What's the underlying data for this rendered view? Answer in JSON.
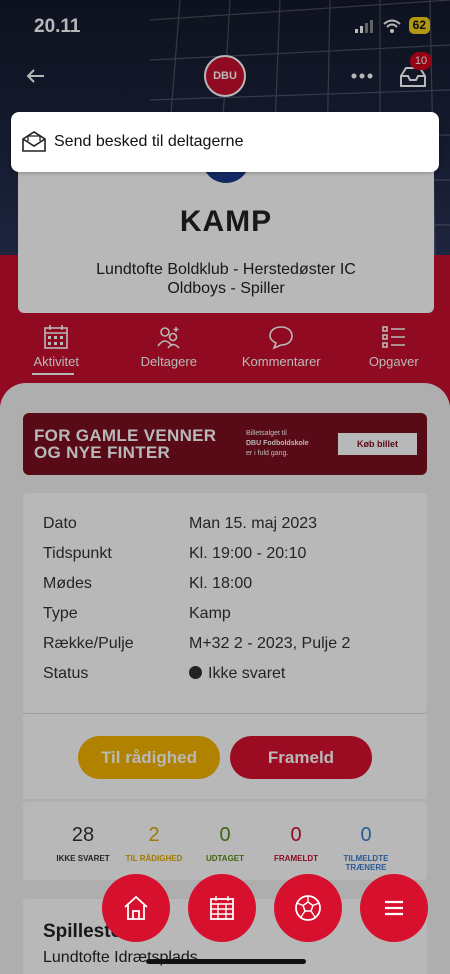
{
  "status_bar": {
    "time": "20.11",
    "battery": "62"
  },
  "header": {
    "logo_text": "DBU",
    "inbox_badge": "10"
  },
  "toast": {
    "label": "Send besked til deltagerne"
  },
  "event_card": {
    "title": "KAMP",
    "subtitle_line1": "Lundtofte Boldklub - Herstedøster IC",
    "subtitle_line2": "Oldboys - Spiller"
  },
  "tabs": [
    {
      "label": "Aktivitet",
      "icon": "calendar-icon",
      "active": true
    },
    {
      "label": "Deltagere",
      "icon": "people-icon",
      "active": false
    },
    {
      "label": "Kommentarer",
      "icon": "comment-icon",
      "active": false
    },
    {
      "label": "Opgaver",
      "icon": "checklist-icon",
      "active": false
    }
  ],
  "banner": {
    "line1": "FOR GAMLE VENNER",
    "line2": "OG NYE FINTER",
    "small_line1": "Billetsalget til",
    "small_line2": "DBU Fodboldskole",
    "small_line3": "er i fuld gang.",
    "button": "Køb billet"
  },
  "details": [
    {
      "key": "Dato",
      "value": "Man 15. maj 2023"
    },
    {
      "key": "Tidspunkt",
      "value": "Kl. 19:00 - 20:10"
    },
    {
      "key": "Mødes",
      "value": "Kl. 18:00"
    },
    {
      "key": "Type",
      "value": "Kamp"
    },
    {
      "key": "Række/Pulje",
      "value": "M+32 2 - 2023, Pulje 2"
    },
    {
      "key": "Status",
      "value": "Ikke svaret"
    }
  ],
  "actions": {
    "available": "Til rådighed",
    "decline": "Frameld"
  },
  "stats": [
    {
      "count": "28",
      "label": "IKKE SVARET",
      "color": "#333333"
    },
    {
      "count": "2",
      "label": "TIL RÅDIGHED",
      "color": "#e0a800"
    },
    {
      "count": "0",
      "label": "UDTAGET",
      "color": "#5a8a1a"
    },
    {
      "count": "0",
      "label": "FRAMELDT",
      "color": "#c8102e"
    },
    {
      "count": "0",
      "label_line1": "TILMELDTE",
      "label_line2": "TRÆNERE",
      "color": "#3b7fd0"
    }
  ],
  "venue": {
    "title": "Spillested",
    "name": "Lundtofte Idrætsplads"
  },
  "colors": {
    "brand_red": "#c8102e",
    "yellow": "#f4b400",
    "navy": "#1d2540"
  }
}
